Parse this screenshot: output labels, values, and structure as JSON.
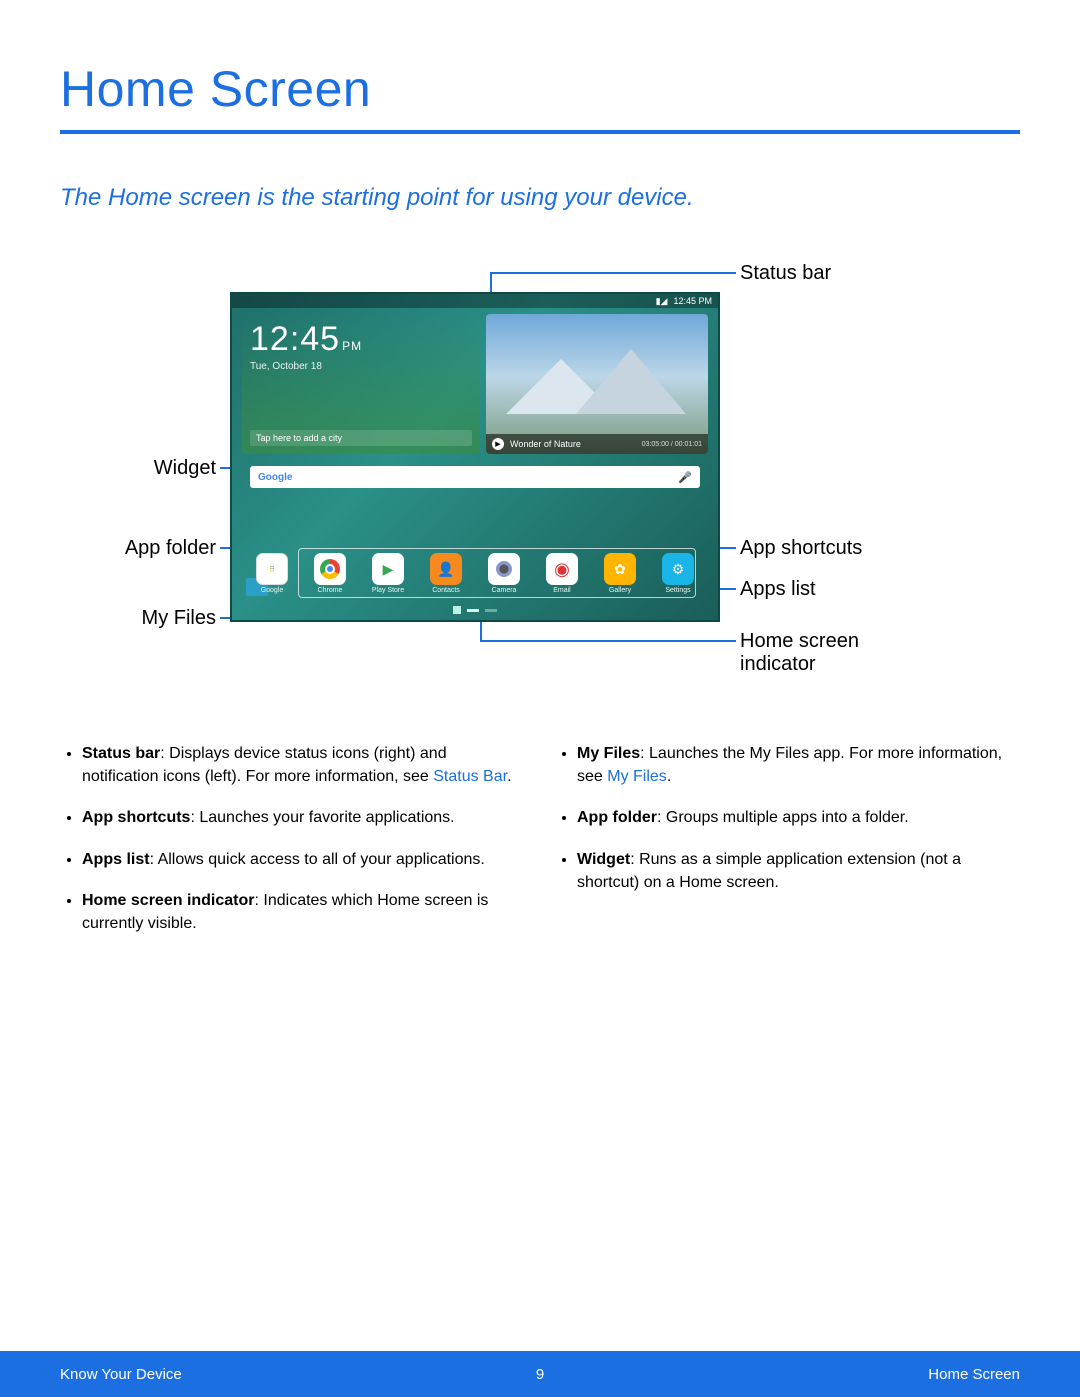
{
  "title": "Home Screen",
  "subtitle": "The Home screen is the starting point for using your device.",
  "callouts": {
    "status_bar": "Status bar",
    "widget": "Widget",
    "app_folder": "App folder",
    "my_files": "My Files",
    "app_shortcuts": "App shortcuts",
    "apps_list": "Apps list",
    "home_indicator": "Home screen indicator"
  },
  "tablet": {
    "status_time": "12:45 PM",
    "signal_icon": "▮◢",
    "clock": {
      "time": "12:45",
      "ampm": "PM",
      "date": "Tue, October 18",
      "tap": "Tap here to add a city"
    },
    "nature": {
      "title": "Wonder of Nature",
      "time": "03:05:00 / 00:01:01"
    },
    "search_placeholder": "Google",
    "dock": [
      {
        "label": "Google"
      },
      {
        "label": "Chrome"
      },
      {
        "label": "Play Store"
      },
      {
        "label": "Contacts"
      },
      {
        "label": "Camera"
      },
      {
        "label": "Email"
      },
      {
        "label": "Gallery"
      },
      {
        "label": "Settings"
      }
    ]
  },
  "bullets_left": [
    {
      "term": "Status bar",
      "text": ": Displays device status icons (right) and notification icons (left). For more information, see ",
      "link": "Status Bar",
      "tail": "."
    },
    {
      "term": "App shortcuts",
      "text": ": Launches your favorite applications."
    },
    {
      "term": "Apps list",
      "text": ": Allows quick access to all of your applications."
    },
    {
      "term": "Home screen indicator",
      "text": ": Indicates which Home screen is currently visible."
    }
  ],
  "bullets_right": [
    {
      "term": "My Files",
      "text": ": Launches the My Files app. For more information, see ",
      "link": "My Files",
      "tail": "."
    },
    {
      "term": "App folder",
      "text": ": Groups multiple apps into a folder."
    },
    {
      "term": "Widget",
      "text": ": Runs as a simple application extension (not a shortcut) on a Home screen."
    }
  ],
  "footer": {
    "left": "Know Your Device",
    "center": "9",
    "right": "Home Screen"
  }
}
